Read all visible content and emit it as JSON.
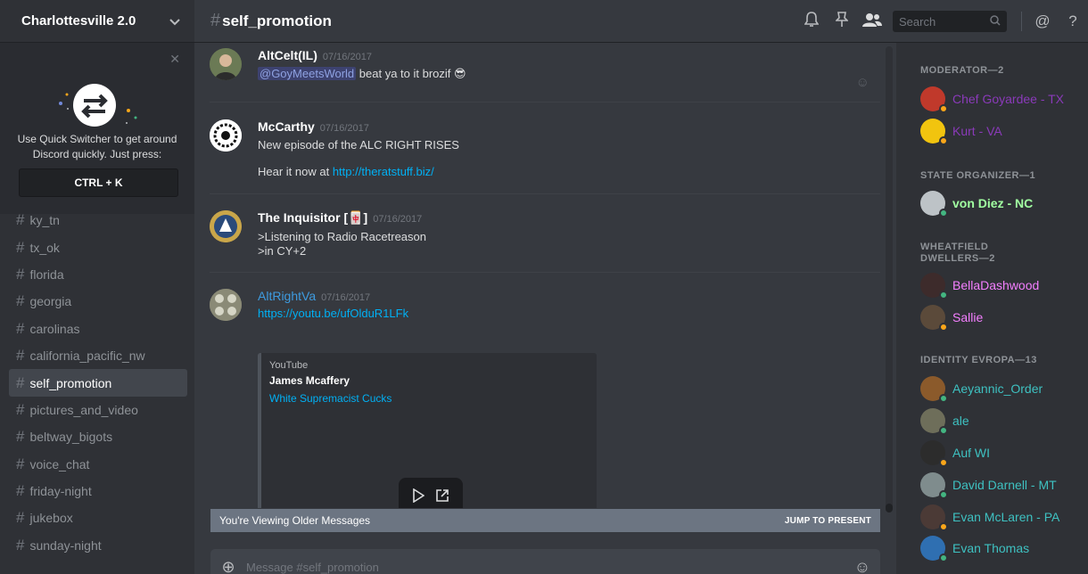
{
  "server": {
    "name": "Charlottesville 2.0"
  },
  "quick_switcher": {
    "text": "Use Quick Switcher to get around Discord quickly. Just press:",
    "shortcut": "CTRL + K"
  },
  "channels": [
    {
      "name": "ky_tn",
      "active": false
    },
    {
      "name": "tx_ok",
      "active": false
    },
    {
      "name": "florida",
      "active": false
    },
    {
      "name": "georgia",
      "active": false
    },
    {
      "name": "carolinas",
      "active": false
    },
    {
      "name": "california_pacific_nw",
      "active": false
    },
    {
      "name": "self_promotion",
      "active": true
    },
    {
      "name": "pictures_and_video",
      "active": false
    },
    {
      "name": "beltway_bigots",
      "active": false
    },
    {
      "name": "voice_chat",
      "active": false
    },
    {
      "name": "friday-night",
      "active": false
    },
    {
      "name": "jukebox",
      "active": false
    },
    {
      "name": "sunday-night",
      "active": false
    }
  ],
  "header": {
    "channel": "self_promotion",
    "search_placeholder": "Search"
  },
  "messages": [
    {
      "user": "AltCelt(IL)",
      "timestamp": "07/16/2017",
      "mention": "@GoyMeetsWorld",
      "text": "beat ya to it brozif 😎"
    },
    {
      "user": "McCarthy",
      "timestamp": "07/16/2017",
      "line1": "New episode of the ALC RIGHT RISES",
      "line2_prefix": "Hear it now at",
      "link": "http://theratstuff.biz/"
    },
    {
      "user": "The Inquisitor [🀄]",
      "timestamp": "07/16/2017",
      "line1": ">Listening to Radio Racetreason",
      "line2": ">in CY+2"
    },
    {
      "user": "AltRightVa",
      "timestamp": "07/16/2017",
      "link": "https://youtu.be/ufOlduR1LFk",
      "embed": {
        "provider": "YouTube",
        "author": "James Mcaffery",
        "title": "White Supremacist Cucks"
      }
    }
  ],
  "older_bar": {
    "text": "You're Viewing Older Messages",
    "jump": "JUMP TO PRESENT"
  },
  "composer": {
    "placeholder": "Message #self_promotion"
  },
  "members": {
    "groups": [
      {
        "title": "MODERATOR—2",
        "members": [
          {
            "name": "Chef Goyardee - TX",
            "color": "#8a3ab9",
            "status": "#faa61a",
            "avatar": "#c0392b"
          },
          {
            "name": "Kurt - VA",
            "color": "#8a3ab9",
            "status": "#faa61a",
            "avatar": "#f1c40f"
          }
        ]
      },
      {
        "title": "STATE ORGANIZER—1",
        "members": [
          {
            "name": "von Diez - NC",
            "color": "#a1ffa1",
            "status": "#43b581",
            "avatar": "#bdc3c7"
          }
        ]
      },
      {
        "title": "WHEATFIELD DWELLERS—2",
        "members": [
          {
            "name": "BellaDashwood",
            "color": "#f47fff",
            "status": "#43b581",
            "avatar": "#3d2b2b"
          },
          {
            "name": "Sallie",
            "color": "#f47fff",
            "status": "#faa61a",
            "avatar": "#5b4a3a"
          }
        ]
      },
      {
        "title": "IDENTITY EVROPA—13",
        "members": [
          {
            "name": "Aeyannic_Order",
            "color": "#3ec1c1",
            "status": "#43b581",
            "avatar": "#8b5a2b"
          },
          {
            "name": "ale",
            "color": "#3ec1c1",
            "status": "#43b581",
            "avatar": "#6e6e5a"
          },
          {
            "name": "Auf WI",
            "color": "#3ec1c1",
            "status": "#faa61a",
            "avatar": "#2c2c2c"
          },
          {
            "name": "David Darnell - MT",
            "color": "#3ec1c1",
            "status": "#43b581",
            "avatar": "#7f8c8d"
          },
          {
            "name": "Evan McLaren - PA",
            "color": "#3ec1c1",
            "status": "#faa61a",
            "avatar": "#4b3a36"
          },
          {
            "name": "Evan Thomas",
            "color": "#3ec1c1",
            "status": "#43b581",
            "avatar": "#2f6fb1"
          }
        ]
      }
    ]
  }
}
